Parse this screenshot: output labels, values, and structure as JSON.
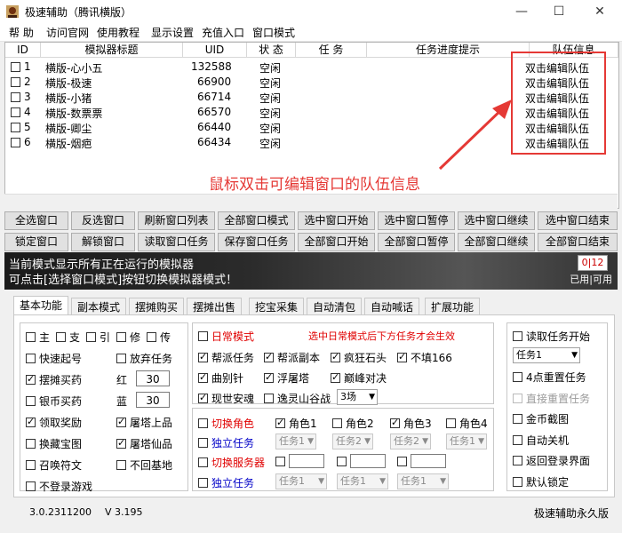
{
  "window": {
    "title": "极速辅助（腾讯横版）",
    "minimize": "—",
    "maximize": "☐",
    "close": "✕"
  },
  "menu": [
    "帮 助",
    "访问官网",
    "使用教程",
    "显示设置",
    "充值入口",
    "窗口模式"
  ],
  "list": {
    "columns": [
      "ID",
      "模拟器标题",
      "UID",
      "状 态",
      "任 务",
      "任务进度提示",
      "队伍信息"
    ],
    "rows": [
      {
        "id": "1",
        "title": "横版-心小五",
        "uid": "132588",
        "status": "空闲",
        "team": "双击编辑队伍"
      },
      {
        "id": "2",
        "title": "横版-极速",
        "uid": "66900",
        "status": "空闲",
        "team": "双击编辑队伍"
      },
      {
        "id": "3",
        "title": "横版-小猪",
        "uid": "66714",
        "status": "空闲",
        "team": "双击编辑队伍"
      },
      {
        "id": "4",
        "title": "横版-数票票",
        "uid": "66570",
        "status": "空闲",
        "team": "双击编辑队伍"
      },
      {
        "id": "5",
        "title": "横版-卿尘",
        "uid": "66440",
        "status": "空闲",
        "team": "双击编辑队伍"
      },
      {
        "id": "6",
        "title": "横版-烟疤",
        "uid": "66434",
        "status": "空闲",
        "team": "双击编辑队伍"
      }
    ]
  },
  "annotation": "鼠标双击可编辑窗口的队伍信息",
  "buttons_row1": [
    "全选窗口",
    "反选窗口",
    "刷新窗口列表",
    "全部窗口模式",
    "选中窗口开始",
    "选中窗口暂停",
    "选中窗口继续",
    "选中窗口结束"
  ],
  "buttons_row2": [
    "锁定窗口",
    "解锁窗口",
    "读取窗口任务",
    "保存窗口任务",
    "全部窗口开始",
    "全部窗口暂停",
    "全部窗口继续",
    "全部窗口结束"
  ],
  "banner": {
    "line1": "当前模式显示所有正在运行的模拟器",
    "line2": "可点击[选择窗口模式]按钮切换模拟器模式！",
    "counter": "0|12",
    "status": "已用|可用"
  },
  "tabs": [
    "基本功能",
    "副本模式",
    "摆摊购买",
    "摆摊出售",
    "挖宝采集",
    "自动清包",
    "自动喊话",
    "扩展功能"
  ],
  "left_group": {
    "row1": [
      "主",
      "支",
      "引",
      "修",
      "传"
    ],
    "options": [
      {
        "label": "快速起号",
        "checked": false
      },
      {
        "label": "放弃任务",
        "checked": false
      },
      {
        "label": "摆摊买药",
        "checked": true
      },
      {
        "label": "银币买药",
        "checked": false
      },
      {
        "label": "领取奖励",
        "checked": true
      },
      {
        "label": "屠塔上品",
        "checked": true
      },
      {
        "label": "换藏宝图",
        "checked": false
      },
      {
        "label": "屠塔仙品",
        "checked": true
      },
      {
        "label": "召唤符文",
        "checked": false
      },
      {
        "label": "不回基地",
        "checked": false
      },
      {
        "label": "不登录游戏",
        "checked": false
      }
    ],
    "red_label": "红",
    "red_value": "30",
    "blue_label": "蓝",
    "blue_value": "30"
  },
  "daily_group": {
    "title": "日常模式",
    "hint": "选中日常模式后下方任务才会生效",
    "options": [
      {
        "label": "帮派任务",
        "checked": true
      },
      {
        "label": "帮派副本",
        "checked": true
      },
      {
        "label": "疯狂石头",
        "checked": true
      },
      {
        "label": "不填166",
        "checked": true
      },
      {
        "label": "曲别针",
        "checked": true
      },
      {
        "label": "浮屠塔",
        "checked": true
      },
      {
        "label": "巅峰对决",
        "checked": true
      },
      {
        "label": "现世安魂",
        "checked": true
      },
      {
        "label": "逸灵山谷战",
        "checked": false
      }
    ],
    "rounds": "3场"
  },
  "switch_group": {
    "switch_role": "切换角色",
    "roles": [
      {
        "label": "角色1",
        "checked": true
      },
      {
        "label": "角色2",
        "checked": false
      },
      {
        "label": "角色3",
        "checked": true
      },
      {
        "label": "角色4",
        "checked": false
      }
    ],
    "independent_task": "独立任务",
    "task_selects": [
      "任务1",
      "任务2",
      "任务2",
      "任务1"
    ],
    "switch_server": "切换服务器",
    "independent_task2": "独立任务",
    "task_selects2": [
      "任务1",
      "任务1",
      "任务1"
    ]
  },
  "right_group": {
    "read_task": "读取任务开始",
    "task_select": "任务1",
    "options": [
      {
        "label": "4点重置任务",
        "checked": false,
        "disabled": false
      },
      {
        "label": "直接重置任务",
        "checked": false,
        "disabled": true
      },
      {
        "label": "金币截图",
        "checked": false,
        "disabled": false
      },
      {
        "label": "自动关机",
        "checked": false,
        "disabled": false
      },
      {
        "label": "返回登录界面",
        "checked": false,
        "disabled": false
      },
      {
        "label": "默认锁定",
        "checked": false,
        "disabled": false
      }
    ]
  },
  "status": {
    "version": "3.0.2311200",
    "v": "V 3.195",
    "right": "极速辅助永久版"
  },
  "colors": {
    "accent_red": "#e53935",
    "blue_label": "#0000c8"
  }
}
